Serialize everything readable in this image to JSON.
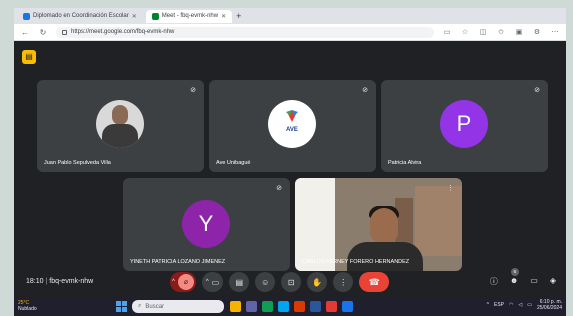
{
  "browser": {
    "tabs": [
      {
        "label": "Diplomado en Coordinación Escolar",
        "active": false
      },
      {
        "label": "Meet - fbq-evmk-nhw",
        "active": true
      }
    ],
    "url": "https://meet.google.com/fbq-evmk-nhw"
  },
  "participants": [
    {
      "name": "Juan Pablo Sepulveda Villa",
      "avatar": "photo"
    },
    {
      "name": "Ave Unibagué",
      "avatar": "logo",
      "logo_text": "AVE Universidad de Ibagué"
    },
    {
      "name": "Patricia Alvira",
      "avatar": "letter",
      "letter": "P",
      "color": "#9334e6"
    },
    {
      "name": "YINETH PATRICIA LOZANO JIMENEZ",
      "avatar": "letter",
      "letter": "Y",
      "color": "#8e24aa"
    },
    {
      "name": "CARLOS FERNEY FORERO HERNANDEZ",
      "avatar": "camera"
    }
  ],
  "meeting": {
    "time": "18:10",
    "code": "fbq-evmk-nhw",
    "participant_count": "6"
  },
  "taskbar": {
    "weather_temp": "25°C",
    "weather_desc": "Nublado",
    "search_placeholder": "Buscar",
    "lang": "ESP",
    "clock_time": "6:10 p. m.",
    "clock_date": "25/06/2024"
  },
  "colors": {
    "meet_bg": "#202124",
    "tile_bg": "#3c4043",
    "hangup": "#ea4335"
  }
}
